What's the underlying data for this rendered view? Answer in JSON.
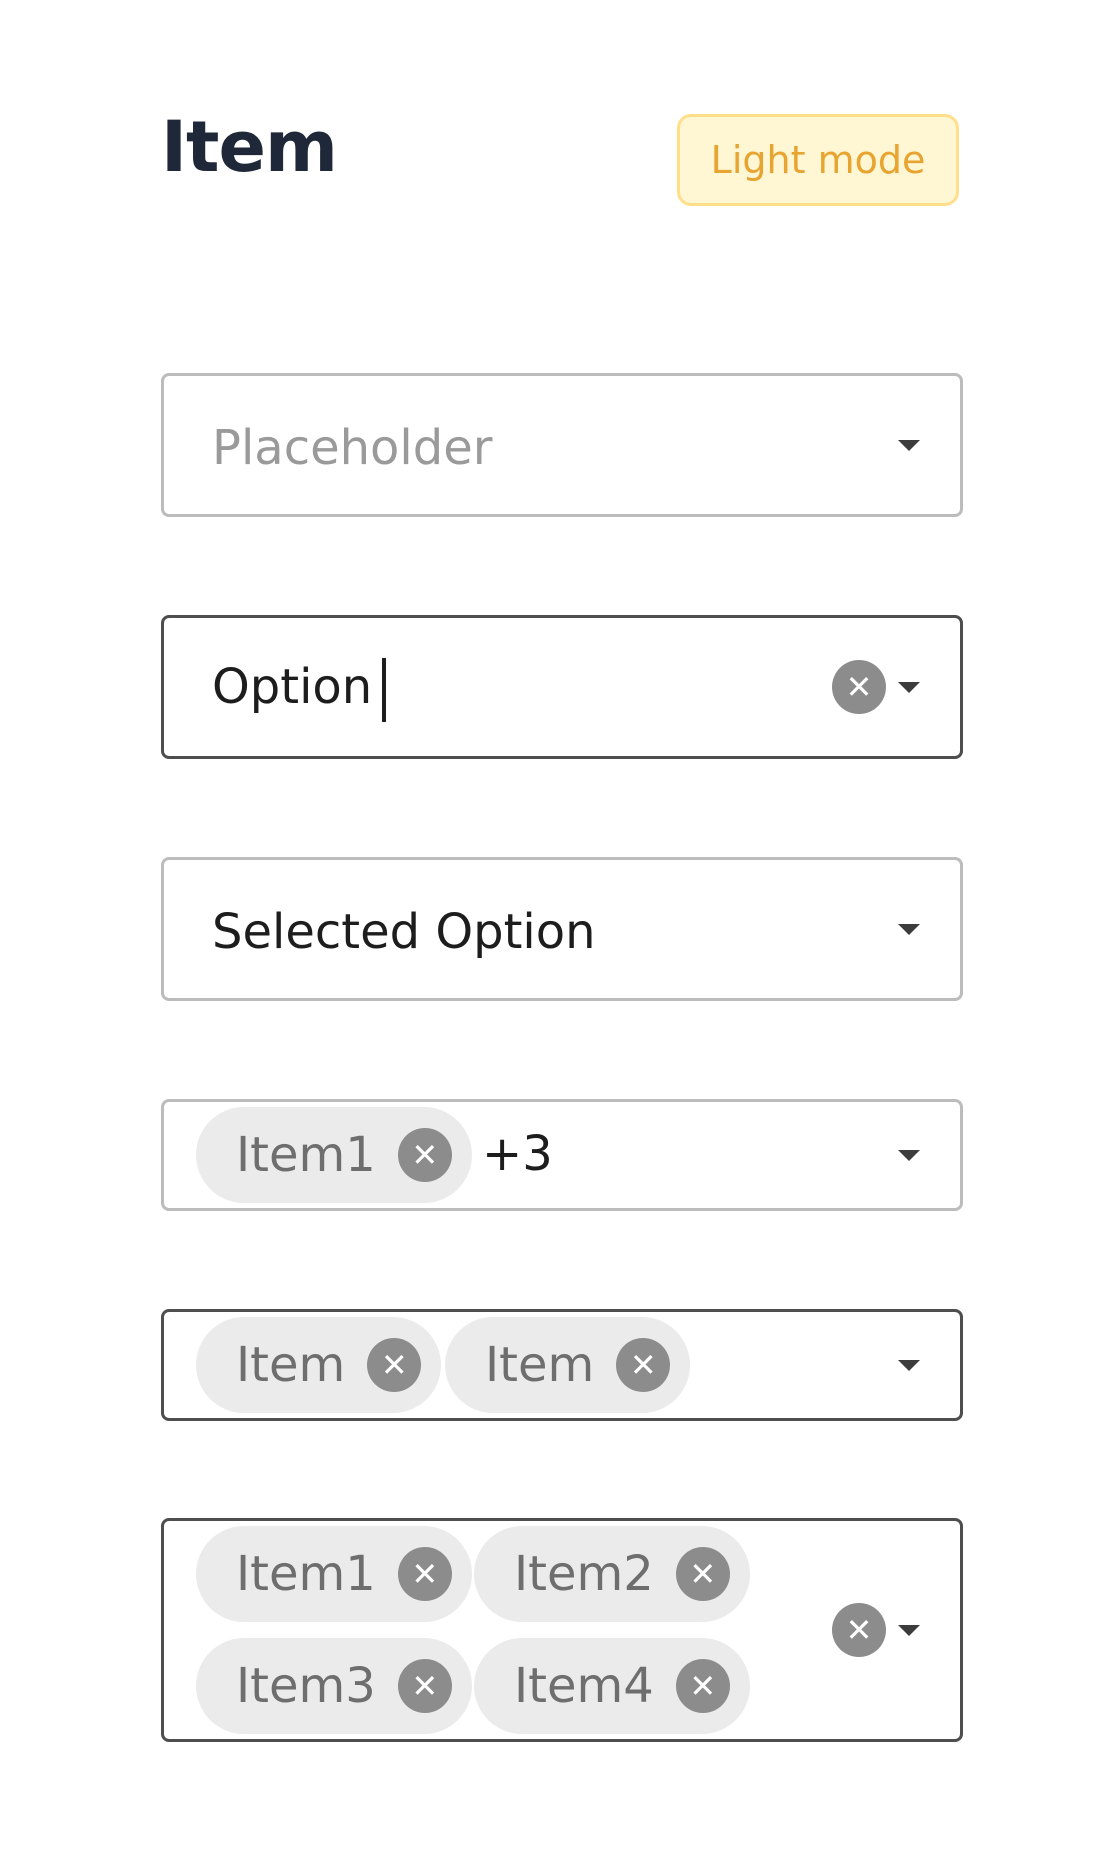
{
  "header": {
    "title": "Item",
    "mode_badge": "Light mode"
  },
  "icons": {
    "dropdown": "chevron-down-icon",
    "clear": "close-icon"
  },
  "colors": {
    "badge_background": "#fff6d3",
    "badge_border": "#ffdf8c",
    "badge_text": "#e8a430",
    "field_border": "#bcbcbc",
    "field_border_active": "#4e4e4e",
    "chip_background": "#ebebeb",
    "remove_button": "#8c8c8c"
  },
  "select_placeholder": {
    "placeholder": "Placeholder"
  },
  "select_typing": {
    "value": "Option"
  },
  "select_selected": {
    "value": "Selected Option"
  },
  "select_multi_collapsed": {
    "chips": [
      "Item1"
    ],
    "more_count": "+3"
  },
  "select_multi_two": {
    "chips": [
      "Item",
      "Item"
    ]
  },
  "select_multi_wrapped": {
    "chips": [
      "Item1",
      "Item2",
      "Item3",
      "Item4"
    ]
  },
  "glyphs": {
    "close": "✕"
  }
}
